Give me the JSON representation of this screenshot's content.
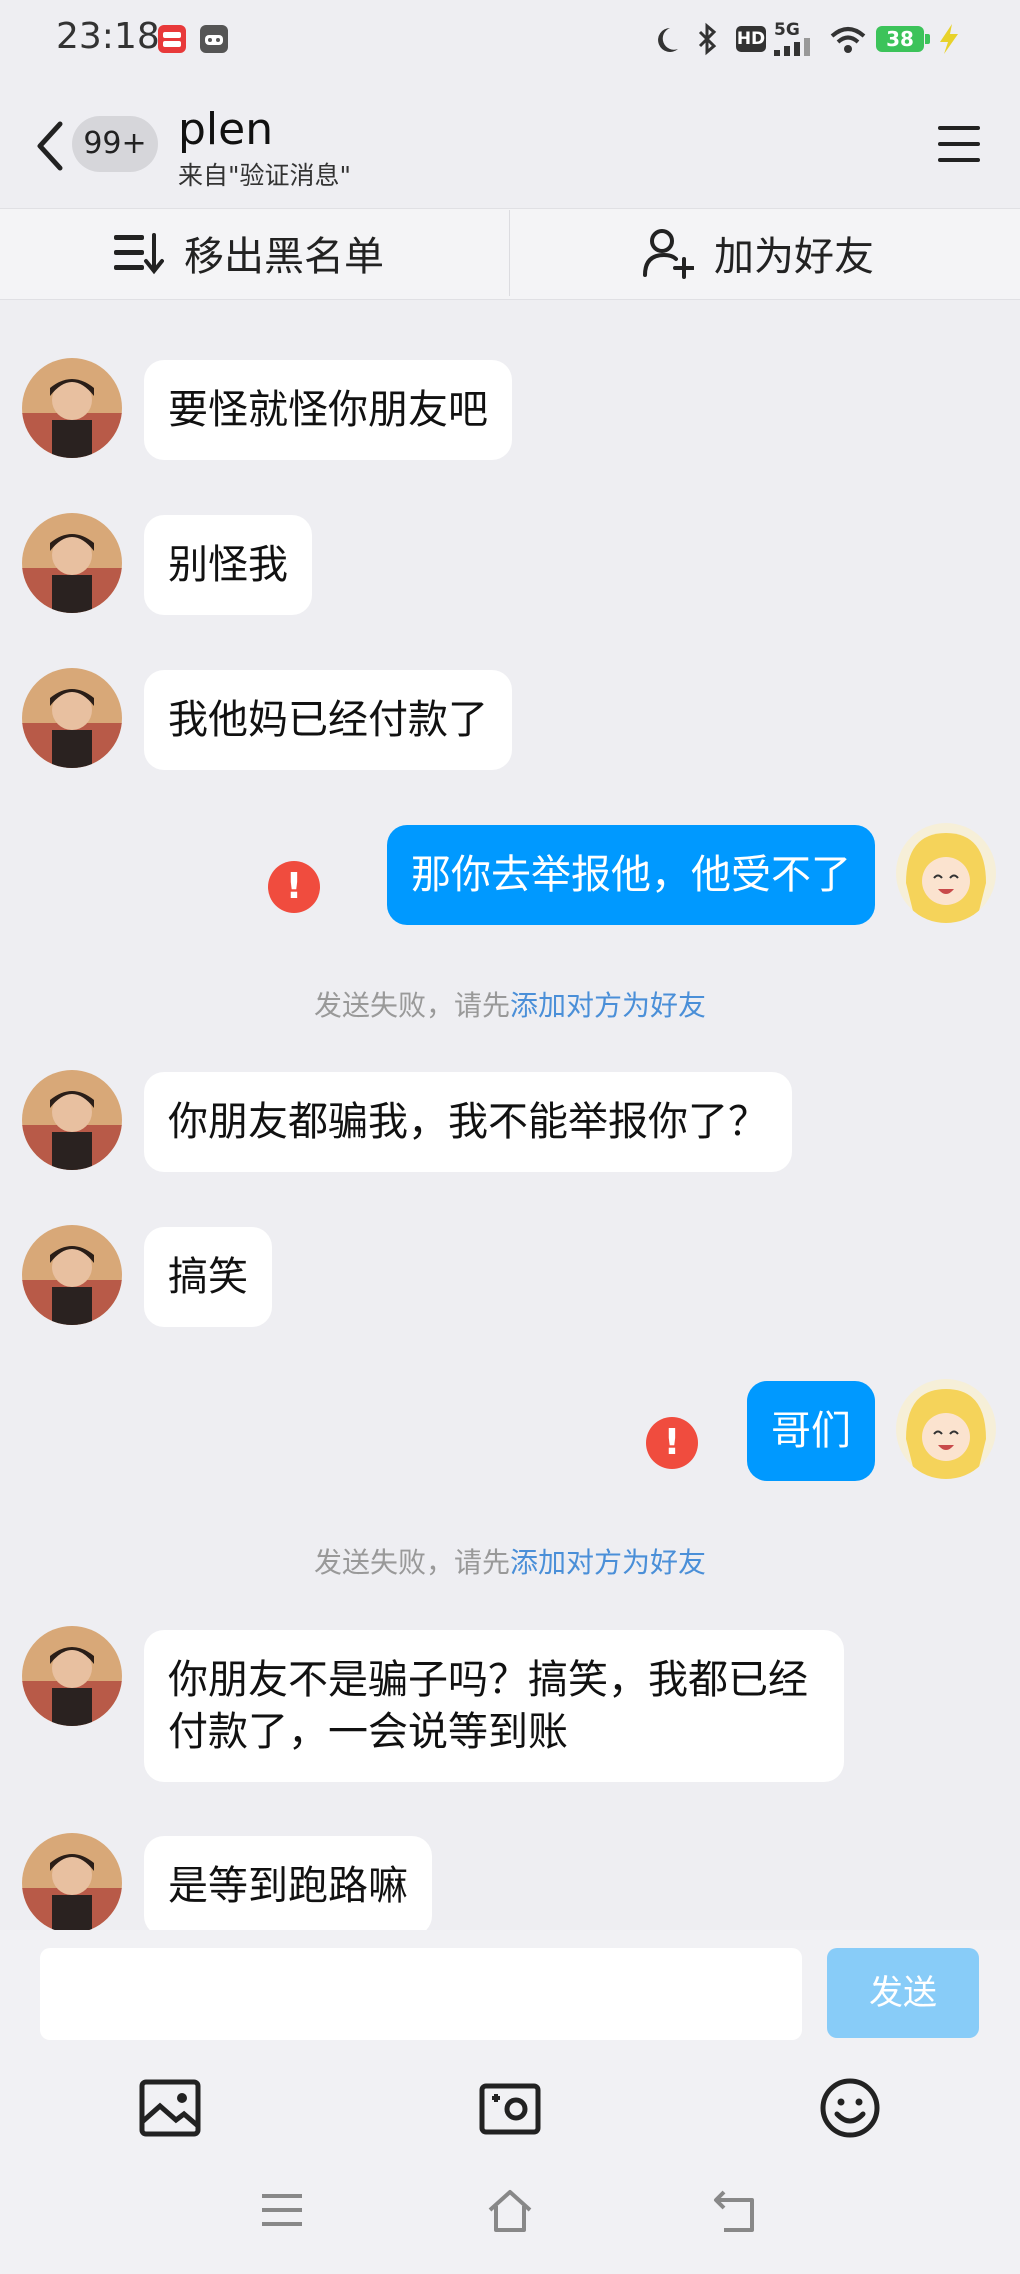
{
  "status_bar": {
    "time": "23:18",
    "network": "5G",
    "hd": "HD",
    "battery": "38"
  },
  "header": {
    "unread_badge": "99+",
    "contact_name": "plen",
    "source": "来自\"验证消息\""
  },
  "actions": {
    "remove_blacklist": "移出黑名单",
    "add_friend": "加为好友"
  },
  "messages": [
    {
      "sender": "other",
      "text": "要怪就怪你朋友吧"
    },
    {
      "sender": "other",
      "text": "别怪我"
    },
    {
      "sender": "other",
      "text": "我他妈已经付款了"
    },
    {
      "sender": "me",
      "text": "那你去举报他，他受不了",
      "failed": true
    },
    {
      "sender": "system",
      "text": "发送失败，请先",
      "link": "添加对方为好友"
    },
    {
      "sender": "other",
      "text": "你朋友都骗我，我不能举报你了？"
    },
    {
      "sender": "other",
      "text": "搞笑"
    },
    {
      "sender": "me",
      "text": "哥们",
      "failed": true
    },
    {
      "sender": "system",
      "text": "发送失败，请先",
      "link": "添加对方为好友"
    },
    {
      "sender": "other",
      "text": "你朋友不是骗子吗？搞笑，我都已经付款了，一会说等到账"
    },
    {
      "sender": "other",
      "text": "是等到跑路嘛"
    }
  ],
  "input": {
    "placeholder": "",
    "send_label": "发送"
  },
  "colors": {
    "accent": "#0099FF",
    "error": "#F04C3E",
    "link": "#4A8FD8"
  }
}
